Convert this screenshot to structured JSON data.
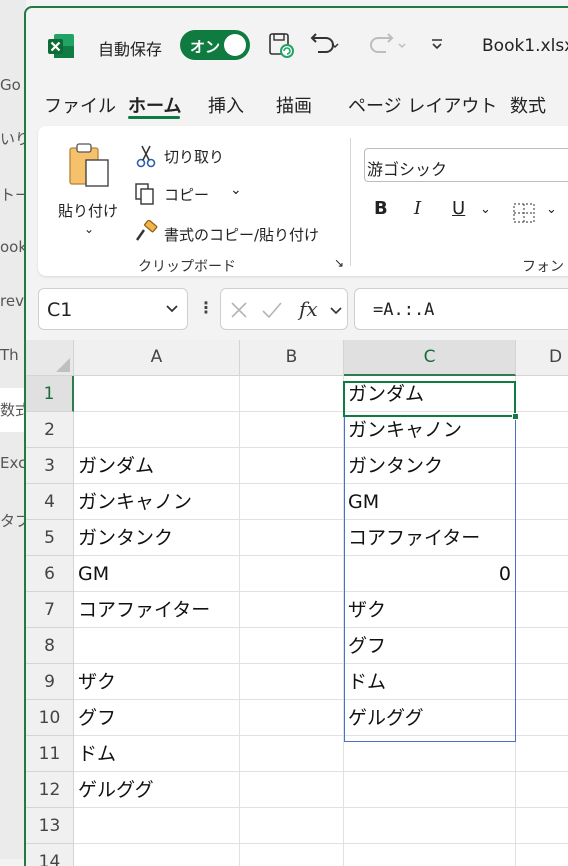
{
  "background_window": {
    "items": [
      "Go",
      "いり",
      "トー",
      "ook",
      "revi",
      "Th",
      "数式",
      "Exc",
      "タブ"
    ],
    "selected_index": 6
  },
  "titlebar": {
    "autosave_label": "自動保存",
    "autosave_toggle": "オン",
    "book_title": "Book1.xlsx"
  },
  "tabs": [
    "ファイル",
    "ホーム",
    "挿入",
    "描画",
    "ページ レイアウト",
    "数式"
  ],
  "active_tab": "ホーム",
  "ribbon": {
    "paste_label": "貼り付け",
    "cut_label": "切り取り",
    "copy_label": "コピー",
    "format_painter_label": "書式のコピー/貼り付け",
    "clipboard_group": "クリップボード",
    "font_name": "游ゴシック",
    "font_group": "フォント",
    "bold": "B",
    "italic": "I",
    "underline": "U"
  },
  "formula_bar": {
    "name_box": "C1",
    "fx": "fx",
    "formula": "=A.:.A"
  },
  "grid": {
    "columns": [
      "A",
      "B",
      "C",
      "D"
    ],
    "selected_column": "C",
    "rows": [
      {
        "num": "1",
        "A": "",
        "B": "",
        "C": "ガンダム"
      },
      {
        "num": "2",
        "A": "",
        "B": "",
        "C": "ガンキャノン"
      },
      {
        "num": "3",
        "A": "ガンダム",
        "B": "",
        "C": "ガンタンク"
      },
      {
        "num": "4",
        "A": "ガンキャノン",
        "B": "",
        "C": "GM"
      },
      {
        "num": "5",
        "A": "ガンタンク",
        "B": "",
        "C": "コアファイター"
      },
      {
        "num": "6",
        "A": "GM",
        "B": "",
        "C": "0"
      },
      {
        "num": "7",
        "A": "コアファイター",
        "B": "",
        "C": "ザク"
      },
      {
        "num": "8",
        "A": "",
        "B": "",
        "C": "グフ"
      },
      {
        "num": "9",
        "A": "ザク",
        "B": "",
        "C": "ドム"
      },
      {
        "num": "10",
        "A": "グフ",
        "B": "",
        "C": "ゲルググ"
      },
      {
        "num": "11",
        "A": "ドム",
        "B": "",
        "C": ""
      },
      {
        "num": "12",
        "A": "ゲルググ",
        "B": "",
        "C": ""
      },
      {
        "num": "13",
        "A": "",
        "B": "",
        "C": ""
      },
      {
        "num": "14",
        "A": "",
        "B": "",
        "C": ""
      }
    ]
  },
  "colors": {
    "excel_green": "#107c41",
    "spill_border": "#4a6fc9"
  }
}
